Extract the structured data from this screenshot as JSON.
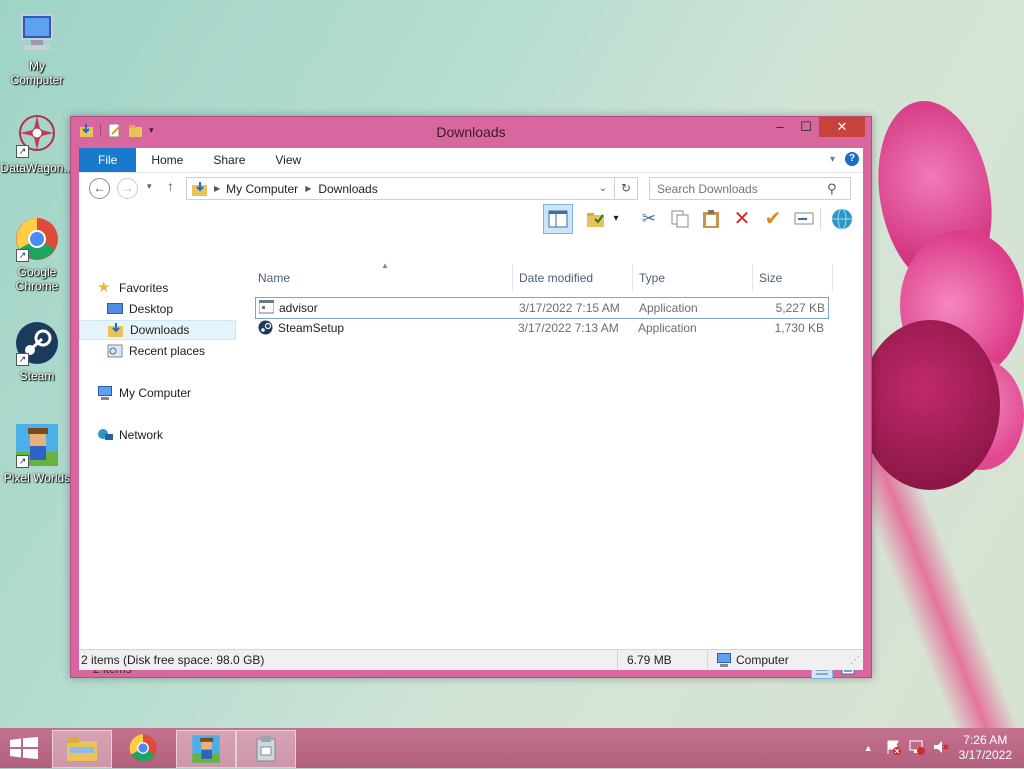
{
  "desktop": {
    "icons": [
      {
        "label": "My\nComputer",
        "icon": "computer-icon"
      },
      {
        "label": "DataWagon...",
        "icon": "datawagon-icon"
      },
      {
        "label": "Google\nChrome",
        "icon": "chrome-icon"
      },
      {
        "label": "Steam",
        "icon": "steam-icon"
      },
      {
        "label": "Pixel Worlds",
        "icon": "pixel-worlds-icon"
      }
    ]
  },
  "window": {
    "title": "Downloads",
    "controls": {
      "minimize": "–",
      "maximize": "☐",
      "close": "✕"
    },
    "ribbon": {
      "tabs": [
        "File",
        "Home",
        "Share",
        "View"
      ]
    },
    "address": {
      "crumbs": [
        "My Computer",
        "Downloads"
      ]
    },
    "search": {
      "placeholder": "Search Downloads"
    },
    "nav": {
      "favorites": "Favorites",
      "desktop": "Desktop",
      "downloads": "Downloads",
      "recent": "Recent places",
      "my_computer": "My Computer",
      "network": "Network"
    },
    "columns": {
      "name": "Name",
      "date": "Date modified",
      "type": "Type",
      "size": "Size"
    },
    "files": [
      {
        "name": "advisor",
        "date": "3/17/2022 7:15 AM",
        "type": "Application",
        "size": "5,227 KB"
      },
      {
        "name": "SteamSetup",
        "date": "3/17/2022 7:13 AM",
        "type": "Application",
        "size": "1,730 KB"
      }
    ],
    "item_count": "2 items",
    "status": {
      "summary": "2 items (Disk free space: 98.0 GB)",
      "size": "6.79 MB",
      "location": "Computer"
    }
  },
  "taskbar": {
    "time": "7:26 AM",
    "date": "3/17/2022"
  },
  "colors": {
    "accent": "#1979ca",
    "window_frame": "#d9679f",
    "close_button": "#c7423a",
    "taskbar": "#b96582"
  }
}
